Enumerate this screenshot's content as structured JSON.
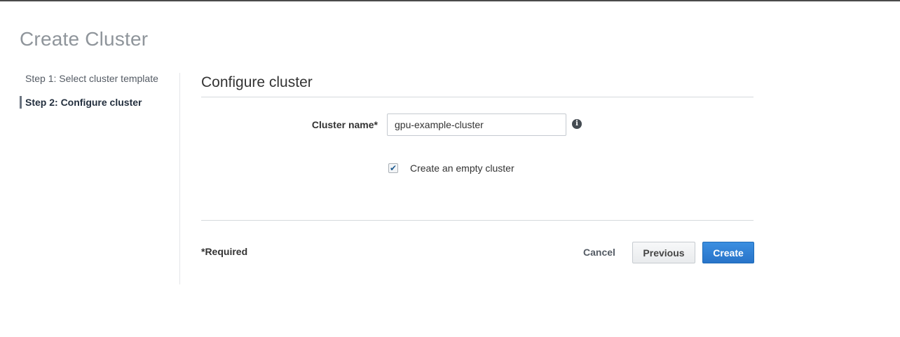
{
  "page": {
    "title": "Create Cluster"
  },
  "steps": [
    {
      "label": "Step 1: Select cluster template",
      "active": false
    },
    {
      "label": "Step 2: Configure cluster",
      "active": true
    }
  ],
  "section": {
    "title": "Configure cluster"
  },
  "form": {
    "cluster_name_label": "Cluster name",
    "required_marker": "*",
    "cluster_name_value": "gpu-example-cluster",
    "info_icon": "info-icon",
    "info_glyph": "i",
    "empty_cluster_label": "Create an empty cluster",
    "empty_cluster_checked": true,
    "check_glyph": "✔"
  },
  "footer": {
    "required_note": "*Required",
    "cancel_label": "Cancel",
    "previous_label": "Previous",
    "create_label": "Create"
  },
  "colors": {
    "primary_button": "#2874c9",
    "title_gray": "#8f959b",
    "active_step_bar": "#6b7480"
  }
}
